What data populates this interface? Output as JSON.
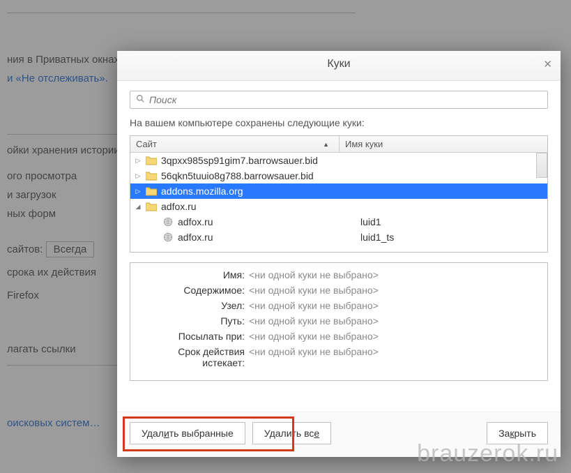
{
  "background": {
    "line1": "ния в Приватных окнах",
    "link1": "и «Не отслеживать».",
    "line3": "ойки хранения истории",
    "line4": "ого просмотра",
    "line5": "и загрузок",
    "line6": "ных форм",
    "line7": "сайтов:",
    "select1": "Всегда",
    "line8": "срока их действия",
    "line9": "Firefox",
    "line10": "лагать ссылки",
    "link2": "оисковых систем…"
  },
  "dialog": {
    "title": "Куки",
    "searchPlaceholder": "Поиск",
    "description": "На вашем компьютере сохранены следующие куки:",
    "columns": {
      "site": "Сайт",
      "cookieName": "Имя куки"
    },
    "rows": [
      {
        "type": "folder",
        "state": "collapsed",
        "label": "3qpxx985sp91gim7.barrowsauer.bid",
        "selected": false
      },
      {
        "type": "folder",
        "state": "collapsed",
        "label": "56qkn5tuuio8g788.barrowsauer.bid",
        "selected": false
      },
      {
        "type": "folder",
        "state": "collapsed",
        "label": "addons.mozilla.org",
        "selected": true
      },
      {
        "type": "folder",
        "state": "expanded",
        "label": "adfox.ru",
        "selected": false
      },
      {
        "type": "cookie",
        "label": "adfox.ru",
        "cookieName": "luid1",
        "selected": false
      },
      {
        "type": "cookie",
        "label": "adfox.ru",
        "cookieName": "luid1_ts",
        "selected": false
      }
    ],
    "details": {
      "name": {
        "label": "Имя:",
        "value": "<ни одной куки не выбрано>"
      },
      "content": {
        "label": "Содержимое:",
        "value": "<ни одной куки не выбрано>"
      },
      "host": {
        "label": "Узел:",
        "value": "<ни одной куки не выбрано>"
      },
      "path": {
        "label": "Путь:",
        "value": "<ни одной куки не выбрано>"
      },
      "send": {
        "label": "Посылать при:",
        "value": "<ни одной куки не выбрано>"
      },
      "expires": {
        "label": "Срок действия истекает:",
        "value": "<ни одной куки не выбрано>"
      }
    },
    "buttons": {
      "removeSelected_pre": "Удал",
      "removeSelected_u": "и",
      "removeSelected_post": "ть выбранные",
      "removeAll_pre": "Удалить вс",
      "removeAll_u": "е",
      "removeAll_post": "",
      "close_pre": "За",
      "close_u": "к",
      "close_post": "рыть"
    }
  },
  "watermark": "brauzerok.ru"
}
